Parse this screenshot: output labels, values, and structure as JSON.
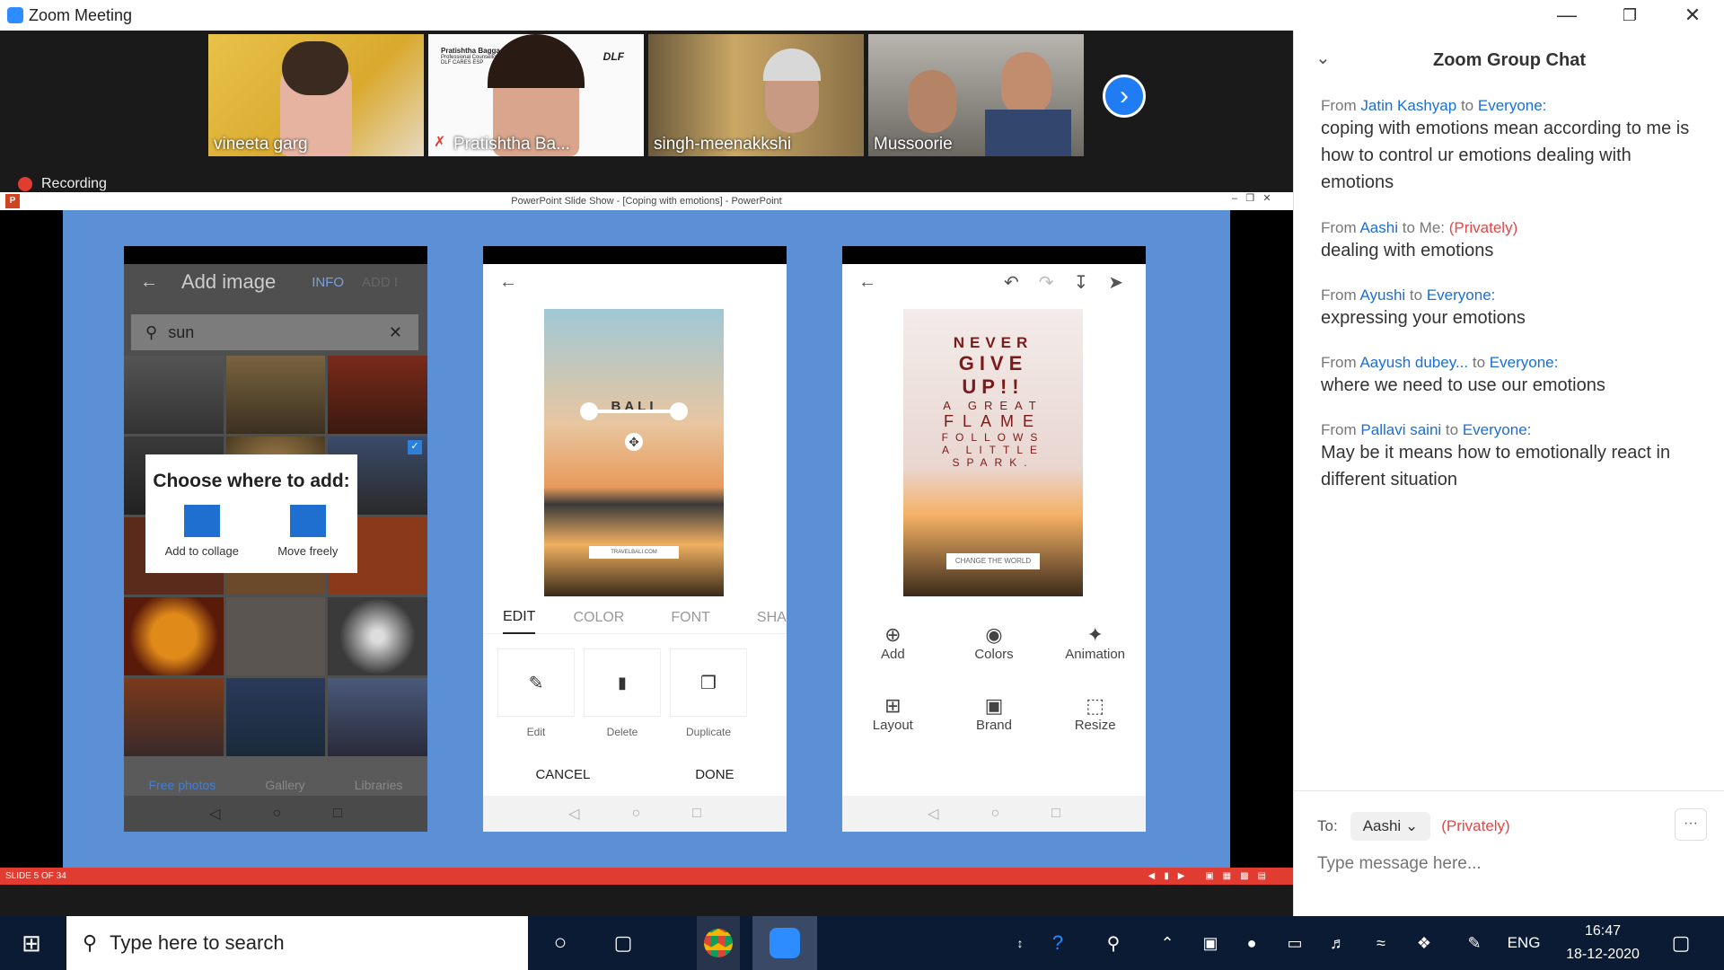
{
  "window": {
    "title": "Zoom Meeting"
  },
  "participants": [
    {
      "name": "vineeta garg"
    },
    {
      "name": "Pratishtha Ba..."
    },
    {
      "name": "singh-meenakkshi"
    },
    {
      "name": "Mussoorie"
    }
  ],
  "badge_text": {
    "line1": "Pratishtha Bagga",
    "line2": "Professional Counsellor",
    "line3": "DLF CARES ESP",
    "logo": "DLF"
  },
  "recording_label": "Recording",
  "powerpoint": {
    "title": "PowerPoint Slide Show - [Coping with emotions] - PowerPoint",
    "slide_counter": "SLIDE 5 OF 34"
  },
  "phone1": {
    "title": "Add image",
    "tab_info": "INFO",
    "tab_ghost": "ADD I",
    "search_value": "sun",
    "dialog_title": "Choose where to add:",
    "opt1": "Add to collage",
    "opt2": "Move freely",
    "nav1": "Free photos",
    "nav2": "Gallery",
    "nav3": "Libraries"
  },
  "phone2": {
    "overlay_title": "BALI",
    "overlay_sub": "TRAVELBALI.COM",
    "tabs": [
      "EDIT",
      "COLOR",
      "FONT",
      "SHAPE"
    ],
    "tools": [
      "Edit",
      "Delete",
      "Duplicate"
    ],
    "cancel": "CANCEL",
    "done": "DONE"
  },
  "phone3": {
    "poster_lines": [
      "NEVER",
      "GIVE",
      "UP!!",
      "A GREAT",
      "FLAME",
      "FOLLOWS",
      "A LITTLE",
      "SPARK."
    ],
    "poster_cta": "CHANGE THE WORLD",
    "actions": [
      "Add",
      "Colors",
      "Animation",
      "Layout",
      "Brand",
      "Resize"
    ]
  },
  "chat": {
    "title": "Zoom Group Chat",
    "messages": [
      {
        "from": "Jatin Kashyap",
        "to": "Everyone:",
        "text": "coping with emotions mean according to me is how to control ur emotions dealing with emotions"
      },
      {
        "from": "Aashi",
        "to": "Me:",
        "privately": "(Privately)",
        "text": "dealing with emotions"
      },
      {
        "from": "Ayushi",
        "to": "Everyone:",
        "text": "expressing your emotions"
      },
      {
        "from": "Aayush dubey...",
        "to": "Everyone:",
        "text": "where we need to use our emotions"
      },
      {
        "from": "Pallavi saini",
        "to": "Everyone:",
        "text": "May be it means how to emotionally react in different situation"
      }
    ],
    "from_word": "From",
    "to_word": "to",
    "to_label": "To:",
    "recipient": "Aashi",
    "recipient_note": "(Privately)",
    "more": "···",
    "placeholder": "Type message here..."
  },
  "taskbar": {
    "search_placeholder": "Type here to search",
    "lang": "ENG",
    "time": "16:47",
    "date": "18-12-2020"
  }
}
